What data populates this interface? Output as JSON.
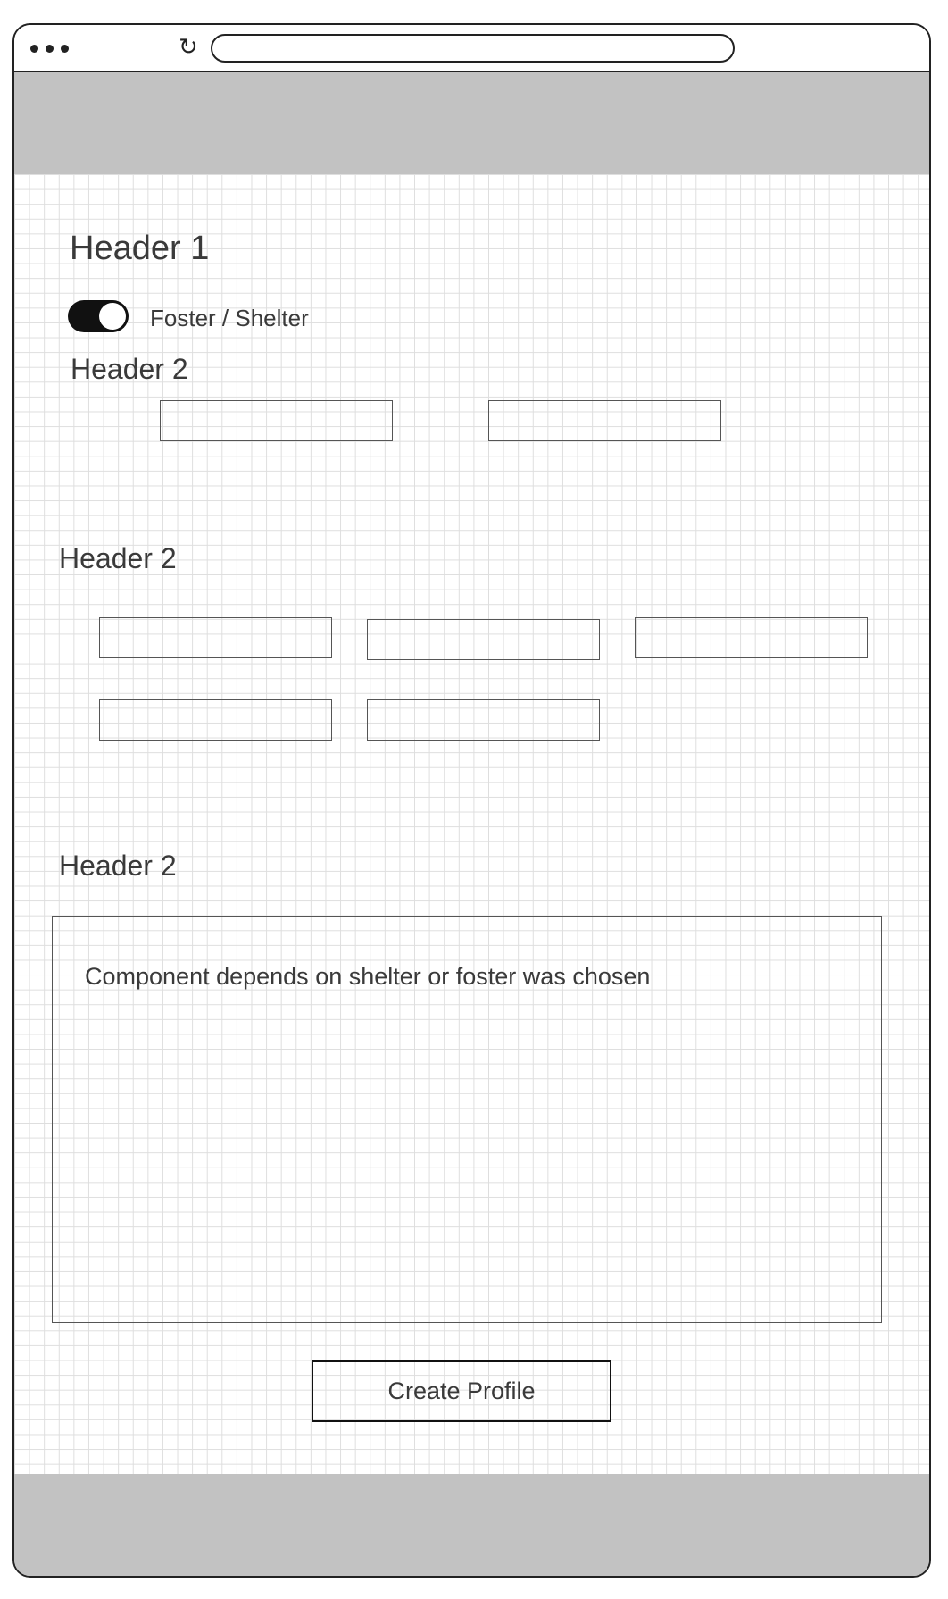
{
  "browser": {
    "menu_icon": "three-dots-icon",
    "reload_icon": "reload-icon",
    "reload_glyph": "↻",
    "url": ""
  },
  "form": {
    "title": "Header 1",
    "toggle": {
      "label": "Foster / Shelter",
      "on": true
    },
    "section1": {
      "header": "Header 2",
      "fields": [
        "",
        ""
      ]
    },
    "section2": {
      "header": "Header 2",
      "fields": [
        "",
        "",
        "",
        "",
        ""
      ]
    },
    "section3": {
      "header": "Header 2",
      "component_text": "Component depends on shelter or foster was chosen"
    },
    "submit_label": "Create Profile"
  },
  "colors": {
    "band": "#c2c2c2",
    "grid": "#dedede",
    "text": "#3a3a3a",
    "frame": "#222222"
  }
}
